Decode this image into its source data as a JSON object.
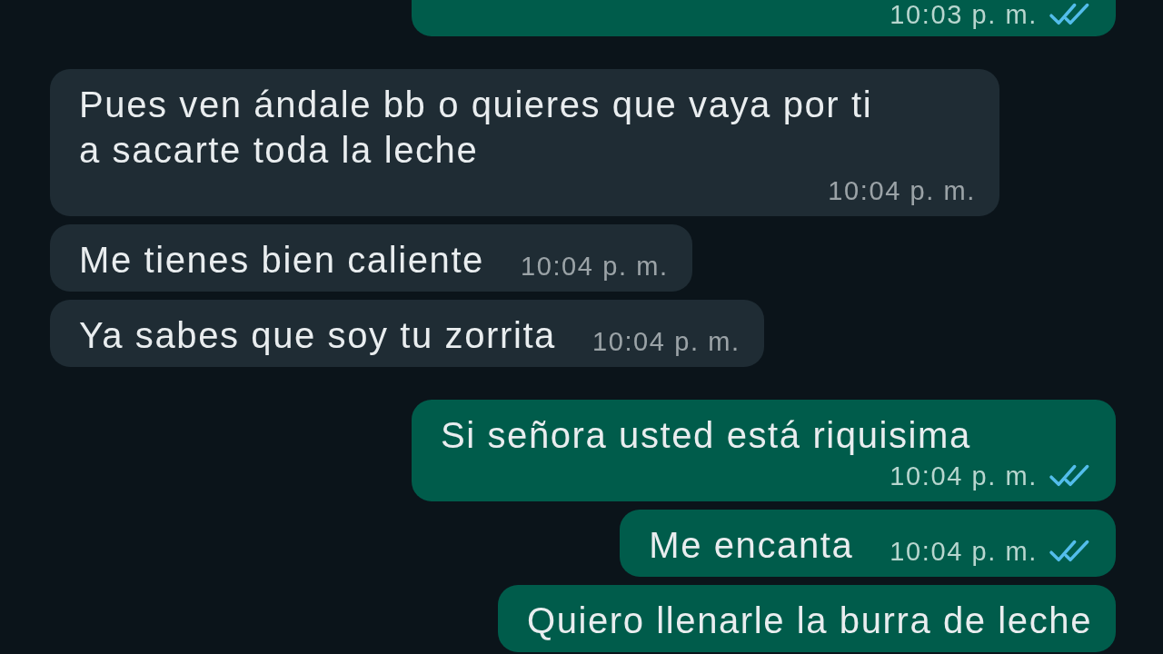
{
  "messages": [
    {
      "kind": "out",
      "time": "10:03 p. m.",
      "read": true
    },
    {
      "kind": "in",
      "text": "Pues ven ándale bb o quieres que vaya por ti a sacarte toda la leche",
      "time": "10:04 p. m."
    },
    {
      "kind": "in",
      "text": "Me tienes bien caliente",
      "time": "10:04 p. m."
    },
    {
      "kind": "in",
      "text": "Ya sabes que soy tu zorrita",
      "time": "10:04 p. m."
    },
    {
      "kind": "out",
      "text": "Si señora usted está riquisima",
      "time": "10:04 p. m.",
      "read": true
    },
    {
      "kind": "out",
      "text": "Me encanta",
      "time": "10:04 p. m.",
      "read": true
    },
    {
      "kind": "out",
      "text": "Quiero llenarle la burra de leche"
    }
  ]
}
